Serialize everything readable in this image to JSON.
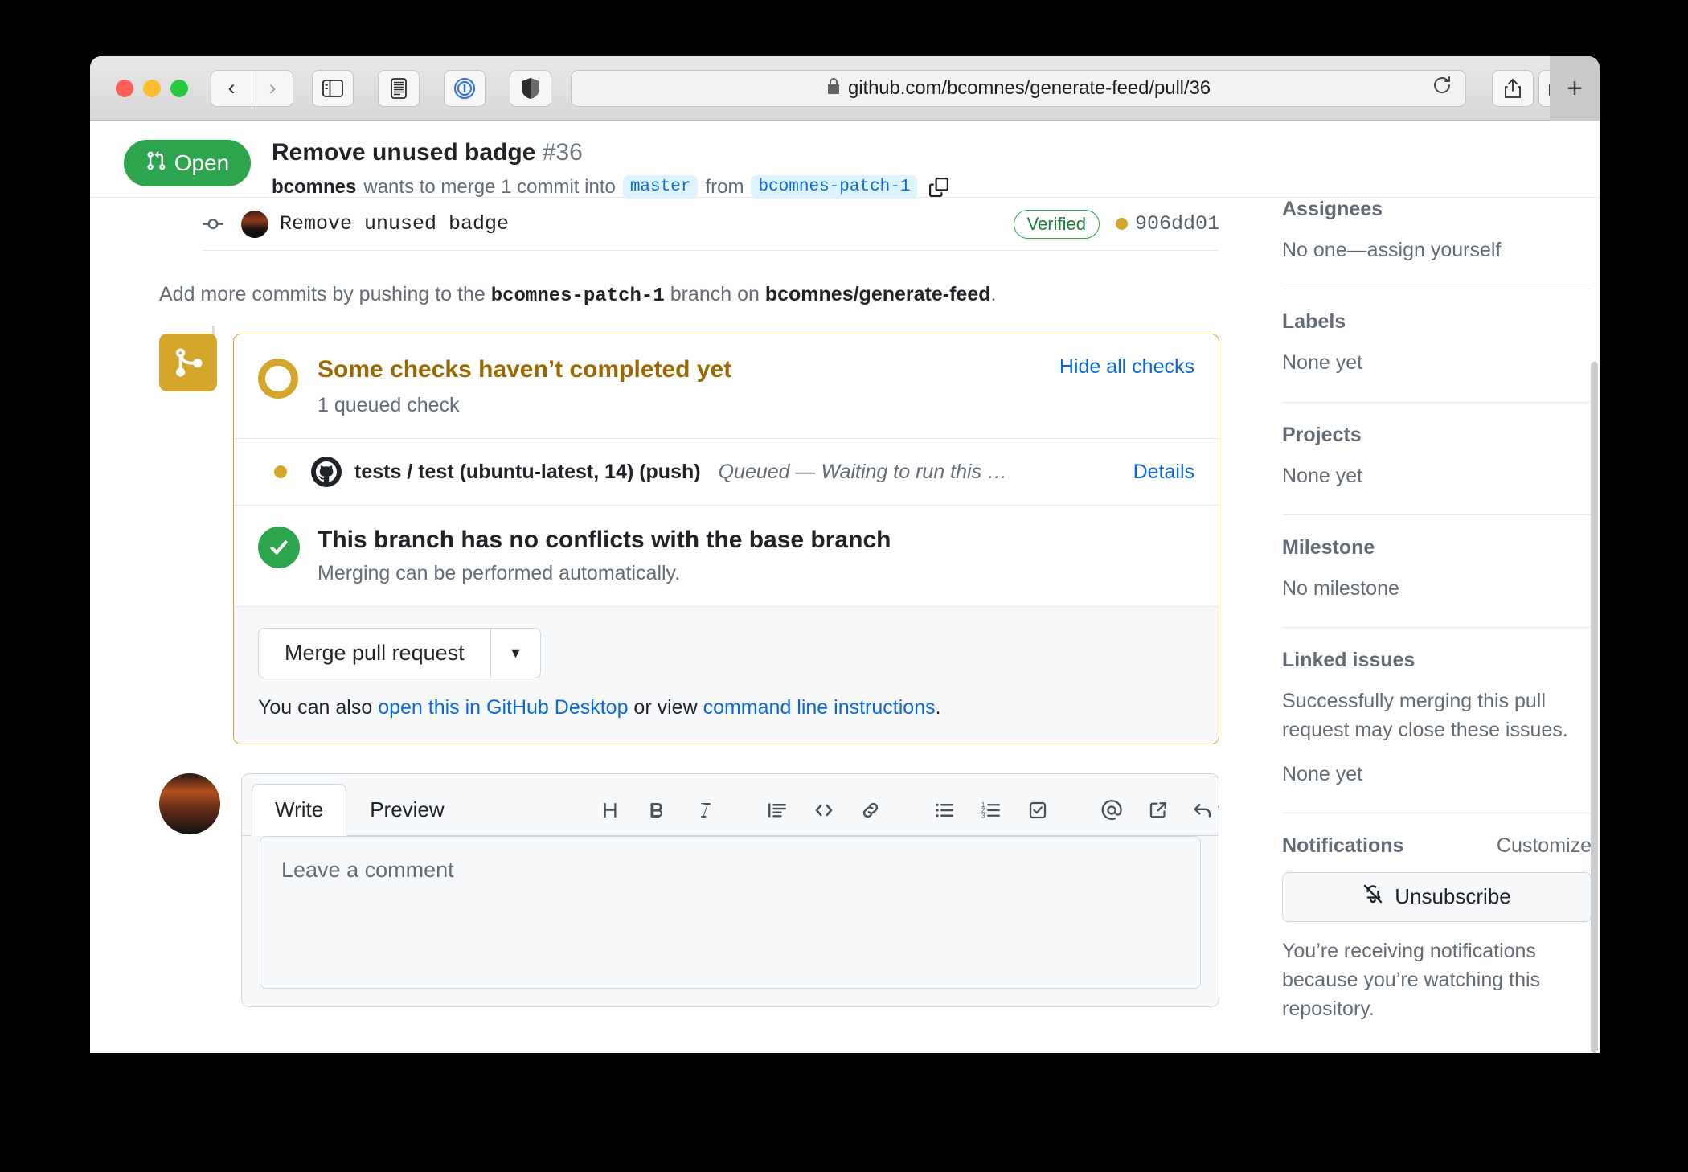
{
  "browser": {
    "url": "github.com/bcomnes/generate-feed/pull/36",
    "lock_icon": "lock-icon",
    "reload_icon": "reload-icon",
    "back_icon": "back-arrow-icon",
    "forward_icon": "forward-arrow-icon",
    "sidebar_icon": "sidebar-toggle-icon",
    "reader_icon": "reader-view-icon",
    "onepassword_icon": "1password-icon",
    "shield_icon": "privacy-shield-icon",
    "share_icon": "share-icon",
    "tabs_icon": "tab-overview-icon",
    "new_tab_label": "+"
  },
  "pr": {
    "state_label": "Open",
    "state_icon": "pull-request-icon",
    "state_color": "#2da44e",
    "title": "Remove unused badge",
    "number": "#36",
    "author": "bcomnes",
    "merge_text_1": "wants to merge 1 commit into",
    "base_branch": "master",
    "merge_text_2": "from",
    "head_branch": "bcomnes-patch-1",
    "copy_icon": "copy-icon"
  },
  "commit": {
    "node_icon": "commit-node-icon",
    "avatar": "author-avatar",
    "message": "Remove  unused  badge",
    "verified_label": "Verified",
    "sha": "906dd01",
    "status_dot_color": "#d4a72c"
  },
  "add_commits": {
    "prefix": "Add more commits by pushing to the",
    "branch": "bcomnes-patch-1",
    "middle": "branch on",
    "repo": "bcomnes/generate-feed",
    "suffix": "."
  },
  "merge_box": {
    "icon": "merge-status-icon",
    "accent_color": "#d4a72c",
    "checks": {
      "title": "Some checks haven’t completed yet",
      "subtitle": "1 queued check",
      "hide_all_label": "Hide all checks",
      "ring_icon": "pending-ring-icon"
    },
    "check_runs": [
      {
        "bullet_icon": "amber-dot-icon",
        "provider_icon": "github-mark-icon",
        "name": "tests / test (ubuntu-latest, 14) (push)",
        "status": "Queued — Waiting to run this …",
        "details_label": "Details"
      }
    ],
    "conflicts": {
      "icon": "green-check-icon",
      "title": "This branch has no conflicts with the base branch",
      "subtitle": "Merging can be performed automatically."
    },
    "actions": {
      "merge_label": "Merge pull request",
      "caret_icon": "chevron-down-icon",
      "also_prefix": "You can also ",
      "desktop_link": "open this in GitHub Desktop",
      "also_middle": " or view ",
      "cli_link": "command line instructions",
      "also_suffix": "."
    }
  },
  "comment": {
    "avatar": "viewer-avatar",
    "tabs": [
      {
        "label": "Write",
        "active": true
      },
      {
        "label": "Preview",
        "active": false
      }
    ],
    "toolbar": [
      {
        "icon": "heading-icon",
        "glyph": "H"
      },
      {
        "icon": "bold-icon",
        "glyph": "B"
      },
      {
        "icon": "italic-icon",
        "glyph": "I"
      },
      {
        "icon": "quote-icon",
        "glyph": "”"
      },
      {
        "icon": "code-icon",
        "glyph": "<>"
      },
      {
        "icon": "link-icon",
        "glyph": "🔗"
      },
      {
        "icon": "unordered-list-icon",
        "glyph": "•"
      },
      {
        "icon": "ordered-list-icon",
        "glyph": "1."
      },
      {
        "icon": "task-list-icon",
        "glyph": "☑"
      },
      {
        "icon": "mention-icon",
        "glyph": "@"
      },
      {
        "icon": "cross-reference-icon",
        "glyph": "↗"
      },
      {
        "icon": "saved-reply-icon",
        "glyph": "↩"
      }
    ],
    "placeholder": "Leave a comment"
  },
  "sidebar": {
    "sections": [
      {
        "heading": "Assignees",
        "body": "No one—assign yourself"
      },
      {
        "heading": "Labels",
        "body": "None yet"
      },
      {
        "heading": "Projects",
        "body": "None yet"
      },
      {
        "heading": "Milestone",
        "body": "No milestone"
      }
    ],
    "linked_issues": {
      "heading": "Linked issues",
      "description": "Successfully merging this pull request may close these issues.",
      "body": "None yet"
    },
    "notifications": {
      "heading": "Notifications",
      "right_label": "Customize",
      "button_label": "Unsubscribe",
      "button_icon": "bell-slash-icon",
      "note": "You’re receiving notifications because you’re watching this repository."
    }
  }
}
